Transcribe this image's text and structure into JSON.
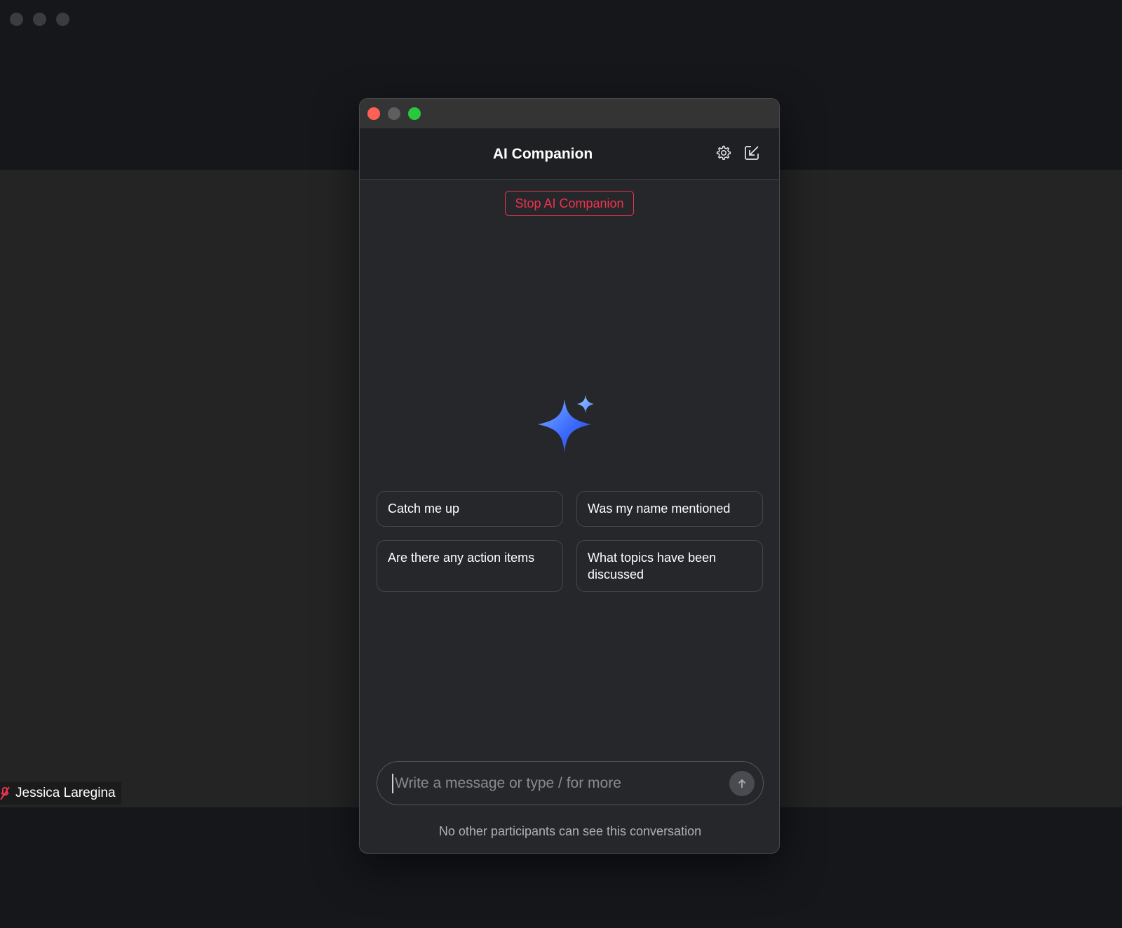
{
  "background": {
    "participant_name": "Jessica Laregina"
  },
  "window": {
    "title": "AI Companion",
    "stop_button_label": "Stop AI Companion",
    "suggestions": [
      "Catch me up",
      "Was my name mentioned",
      "Are there any action items",
      "What topics have been discussed"
    ],
    "input": {
      "value": "",
      "placeholder": "Write a message or type / for more"
    },
    "footer_note": "No other participants can see this conversation"
  },
  "icons": {
    "settings": "gear-icon",
    "popout": "pop-in-arrow-icon",
    "send": "arrow-up-icon",
    "logo": "sparkle-icon",
    "mic": "muted-mic-icon"
  },
  "colors": {
    "accent_red": "#f0324c",
    "sparkle_blue": "#3d6cff",
    "close": "#fe5f57",
    "zoom": "#28c840"
  }
}
